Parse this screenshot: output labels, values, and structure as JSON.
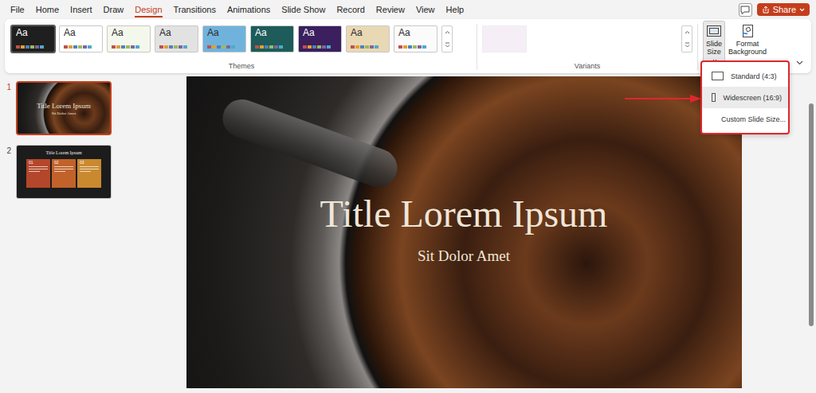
{
  "menu": {
    "tabs": [
      {
        "label": "File",
        "selected": false
      },
      {
        "label": "Home",
        "selected": false
      },
      {
        "label": "Insert",
        "selected": false
      },
      {
        "label": "Draw",
        "selected": false
      },
      {
        "label": "Design",
        "selected": true
      },
      {
        "label": "Transitions",
        "selected": false
      },
      {
        "label": "Animations",
        "selected": false
      },
      {
        "label": "Slide Show",
        "selected": false
      },
      {
        "label": "Record",
        "selected": false
      },
      {
        "label": "Review",
        "selected": false
      },
      {
        "label": "View",
        "selected": false
      },
      {
        "label": "Help",
        "selected": false
      }
    ]
  },
  "share_button": {
    "label": "Share"
  },
  "ribbon": {
    "themes": {
      "label": "Themes",
      "items": [
        {
          "label": "Aa",
          "color": "#1f1f1f",
          "selected": true
        },
        {
          "label": "Aa",
          "color": "#ffffff",
          "selected": false
        },
        {
          "label": "Aa",
          "color": "#f4f8ec",
          "selected": false
        },
        {
          "label": "Aa",
          "color": "#e2e2e2",
          "selected": false
        },
        {
          "label": "Aa",
          "color": "#6fb3dd",
          "selected": false
        },
        {
          "label": "Aa",
          "color": "#1d5c5a",
          "selected": false
        },
        {
          "label": "Aa",
          "color": "#3b1f5e",
          "selected": false
        },
        {
          "label": "Aa",
          "color": "#e9d8b4",
          "selected": false
        },
        {
          "label": "Aa",
          "color": "#fbfbfb",
          "selected": false
        }
      ]
    },
    "variants": {
      "label": "Variants",
      "items": [
        {
          "color": "#f5eef7",
          "selected": false
        }
      ]
    },
    "buttons": [
      {
        "kind": "size",
        "label": "Slide Size",
        "selected": true
      },
      {
        "kind": "background",
        "label": "Format Background",
        "selected": false
      }
    ]
  },
  "slide_size_menu": {
    "items": [
      {
        "kind": "option",
        "label": "Standard (4:3)",
        "selected": false
      },
      {
        "kind": "option",
        "label": "Widescreen (16:9)",
        "selected": true
      },
      {
        "kind": "command",
        "label": "Custom Slide Size...",
        "selected": false
      }
    ]
  },
  "slides": [
    {
      "number": "1",
      "selected": true,
      "kind": "title",
      "title": "Title Lorem Ipsum",
      "subtitle": "Sit Dolor Amet",
      "boxes": []
    },
    {
      "number": "2",
      "selected": false,
      "kind": "columns",
      "title": "Title Lorem Ipsum",
      "subtitle": "",
      "boxes": [
        {
          "label": "01",
          "color": "#b4472b"
        },
        {
          "label": "02",
          "color": "#c1622a"
        },
        {
          "label": "03",
          "color": "#c9892f"
        }
      ]
    }
  ],
  "current_slide": {
    "title": "Title Lorem Ipsum",
    "subtitle": "Sit Dolor Amet"
  }
}
